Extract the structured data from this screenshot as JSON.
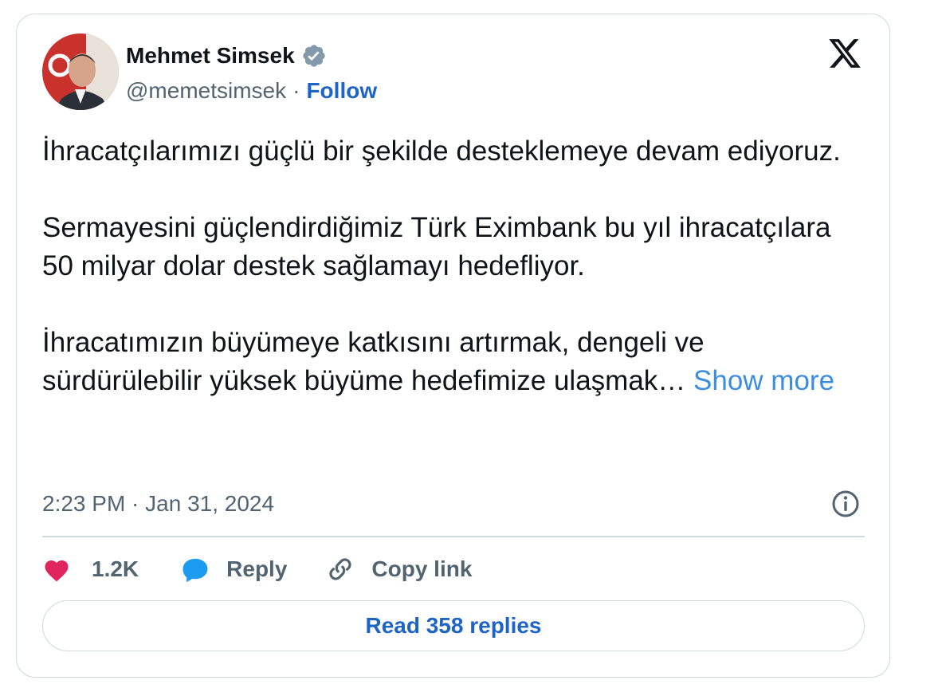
{
  "author": {
    "name": "Mehmet Simsek",
    "handle": "@memetsimsek",
    "separator": "·",
    "follow_label": "Follow"
  },
  "icons": {
    "verified": "verified-badge-icon",
    "brand": "x-logo-icon",
    "info": "info-icon",
    "like": "heart-icon",
    "reply": "speech-bubble-icon",
    "copy": "link-icon"
  },
  "colors": {
    "follow": "#1d64c4",
    "show_more": "#3b8de0",
    "like": "#e0245e",
    "reply": "#1d9bf0",
    "muted": "#536471",
    "border": "#cfd9de"
  },
  "tweet": {
    "text": "İhracatçılarımızı güçlü bir şekilde desteklemeye devam ediyoruz.\n\nSermayesini güçlendirdiğimiz Türk Eximbank bu yıl ihracatçılara 50 milyar dolar destek sağlamayı hedefliyor.\n\nİhracatımızın büyümeye katkısını artırmak, dengeli ve sürdürülebilir yüksek büyüme hedefimize ulaşmak… ",
    "show_more": "Show more",
    "timestamp": "2:23 PM · Jan 31, 2024"
  },
  "actions": {
    "likes": "1.2K",
    "reply_label": "Reply",
    "copy_label": "Copy link"
  },
  "read_replies_label": "Read 358 replies"
}
